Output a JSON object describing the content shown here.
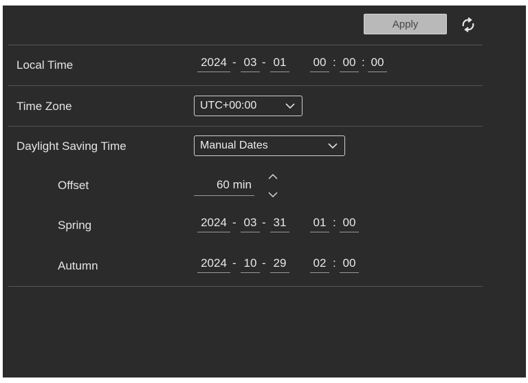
{
  "toolbar": {
    "apply_label": "Apply",
    "refresh_icon": "refresh-icon"
  },
  "local_time": {
    "label": "Local Time",
    "year": "2024",
    "month": "03",
    "day": "01",
    "hour": "00",
    "minute": "00",
    "second": "00",
    "date_sep": "-",
    "time_sep": ":"
  },
  "time_zone": {
    "label": "Time Zone",
    "value": "UTC+00:00"
  },
  "dst": {
    "label": "Daylight Saving Time",
    "mode": "Manual Dates",
    "offset": {
      "label": "Offset",
      "value": "60 min"
    },
    "spring": {
      "label": "Spring",
      "year": "2024",
      "month": "03",
      "day": "31",
      "hour": "01",
      "minute": "00"
    },
    "autumn": {
      "label": "Autumn",
      "year": "2024",
      "month": "10",
      "day": "29",
      "hour": "02",
      "minute": "00"
    }
  },
  "colors": {
    "panel_bg": "#2b2b2b",
    "text": "#e4e4e4",
    "button_bg": "#b9b9b9"
  }
}
